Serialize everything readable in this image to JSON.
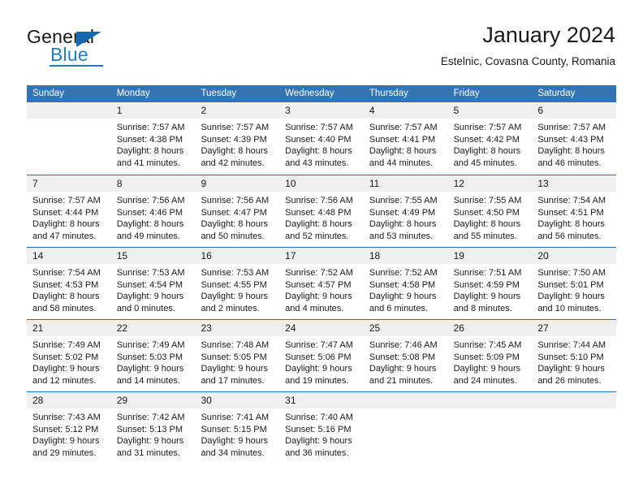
{
  "brand": {
    "name_top": "General",
    "name_bottom": "Blue",
    "logo_icon": "triangle-logo-icon",
    "accent_color": "#1668b0",
    "blue_text_color": "#1d7dc4"
  },
  "header": {
    "title": "January 2024",
    "subtitle": "Estelnic, Covasna County, Romania"
  },
  "theme": {
    "header_row_bg": "#3274b4",
    "header_row_text": "#ffffff",
    "week_separator": "#2a6cae",
    "day_number_band_bg": "#efefef",
    "body_text": "#1a1a1a"
  },
  "calendar": {
    "weekdays": [
      "Sunday",
      "Monday",
      "Tuesday",
      "Wednesday",
      "Thursday",
      "Friday",
      "Saturday"
    ],
    "weeks": [
      [
        {
          "day": "",
          "lines": []
        },
        {
          "day": "1",
          "lines": [
            "Sunrise: 7:57 AM",
            "Sunset: 4:38 PM",
            "Daylight: 8 hours",
            "and 41 minutes."
          ]
        },
        {
          "day": "2",
          "lines": [
            "Sunrise: 7:57 AM",
            "Sunset: 4:39 PM",
            "Daylight: 8 hours",
            "and 42 minutes."
          ]
        },
        {
          "day": "3",
          "lines": [
            "Sunrise: 7:57 AM",
            "Sunset: 4:40 PM",
            "Daylight: 8 hours",
            "and 43 minutes."
          ]
        },
        {
          "day": "4",
          "lines": [
            "Sunrise: 7:57 AM",
            "Sunset: 4:41 PM",
            "Daylight: 8 hours",
            "and 44 minutes."
          ]
        },
        {
          "day": "5",
          "lines": [
            "Sunrise: 7:57 AM",
            "Sunset: 4:42 PM",
            "Daylight: 8 hours",
            "and 45 minutes."
          ]
        },
        {
          "day": "6",
          "lines": [
            "Sunrise: 7:57 AM",
            "Sunset: 4:43 PM",
            "Daylight: 8 hours",
            "and 46 minutes."
          ]
        }
      ],
      [
        {
          "day": "7",
          "lines": [
            "Sunrise: 7:57 AM",
            "Sunset: 4:44 PM",
            "Daylight: 8 hours",
            "and 47 minutes."
          ]
        },
        {
          "day": "8",
          "lines": [
            "Sunrise: 7:56 AM",
            "Sunset: 4:46 PM",
            "Daylight: 8 hours",
            "and 49 minutes."
          ]
        },
        {
          "day": "9",
          "lines": [
            "Sunrise: 7:56 AM",
            "Sunset: 4:47 PM",
            "Daylight: 8 hours",
            "and 50 minutes."
          ]
        },
        {
          "day": "10",
          "lines": [
            "Sunrise: 7:56 AM",
            "Sunset: 4:48 PM",
            "Daylight: 8 hours",
            "and 52 minutes."
          ]
        },
        {
          "day": "11",
          "lines": [
            "Sunrise: 7:55 AM",
            "Sunset: 4:49 PM",
            "Daylight: 8 hours",
            "and 53 minutes."
          ]
        },
        {
          "day": "12",
          "lines": [
            "Sunrise: 7:55 AM",
            "Sunset: 4:50 PM",
            "Daylight: 8 hours",
            "and 55 minutes."
          ]
        },
        {
          "day": "13",
          "lines": [
            "Sunrise: 7:54 AM",
            "Sunset: 4:51 PM",
            "Daylight: 8 hours",
            "and 56 minutes."
          ]
        }
      ],
      [
        {
          "day": "14",
          "lines": [
            "Sunrise: 7:54 AM",
            "Sunset: 4:53 PM",
            "Daylight: 8 hours",
            "and 58 minutes."
          ]
        },
        {
          "day": "15",
          "lines": [
            "Sunrise: 7:53 AM",
            "Sunset: 4:54 PM",
            "Daylight: 9 hours",
            "and 0 minutes."
          ]
        },
        {
          "day": "16",
          "lines": [
            "Sunrise: 7:53 AM",
            "Sunset: 4:55 PM",
            "Daylight: 9 hours",
            "and 2 minutes."
          ]
        },
        {
          "day": "17",
          "lines": [
            "Sunrise: 7:52 AM",
            "Sunset: 4:57 PM",
            "Daylight: 9 hours",
            "and 4 minutes."
          ]
        },
        {
          "day": "18",
          "lines": [
            "Sunrise: 7:52 AM",
            "Sunset: 4:58 PM",
            "Daylight: 9 hours",
            "and 6 minutes."
          ]
        },
        {
          "day": "19",
          "lines": [
            "Sunrise: 7:51 AM",
            "Sunset: 4:59 PM",
            "Daylight: 9 hours",
            "and 8 minutes."
          ]
        },
        {
          "day": "20",
          "lines": [
            "Sunrise: 7:50 AM",
            "Sunset: 5:01 PM",
            "Daylight: 9 hours",
            "and 10 minutes."
          ]
        }
      ],
      [
        {
          "day": "21",
          "lines": [
            "Sunrise: 7:49 AM",
            "Sunset: 5:02 PM",
            "Daylight: 9 hours",
            "and 12 minutes."
          ]
        },
        {
          "day": "22",
          "lines": [
            "Sunrise: 7:49 AM",
            "Sunset: 5:03 PM",
            "Daylight: 9 hours",
            "and 14 minutes."
          ]
        },
        {
          "day": "23",
          "lines": [
            "Sunrise: 7:48 AM",
            "Sunset: 5:05 PM",
            "Daylight: 9 hours",
            "and 17 minutes."
          ]
        },
        {
          "day": "24",
          "lines": [
            "Sunrise: 7:47 AM",
            "Sunset: 5:06 PM",
            "Daylight: 9 hours",
            "and 19 minutes."
          ]
        },
        {
          "day": "25",
          "lines": [
            "Sunrise: 7:46 AM",
            "Sunset: 5:08 PM",
            "Daylight: 9 hours",
            "and 21 minutes."
          ]
        },
        {
          "day": "26",
          "lines": [
            "Sunrise: 7:45 AM",
            "Sunset: 5:09 PM",
            "Daylight: 9 hours",
            "and 24 minutes."
          ]
        },
        {
          "day": "27",
          "lines": [
            "Sunrise: 7:44 AM",
            "Sunset: 5:10 PM",
            "Daylight: 9 hours",
            "and 26 minutes."
          ]
        }
      ],
      [
        {
          "day": "28",
          "lines": [
            "Sunrise: 7:43 AM",
            "Sunset: 5:12 PM",
            "Daylight: 9 hours",
            "and 29 minutes."
          ]
        },
        {
          "day": "29",
          "lines": [
            "Sunrise: 7:42 AM",
            "Sunset: 5:13 PM",
            "Daylight: 9 hours",
            "and 31 minutes."
          ]
        },
        {
          "day": "30",
          "lines": [
            "Sunrise: 7:41 AM",
            "Sunset: 5:15 PM",
            "Daylight: 9 hours",
            "and 34 minutes."
          ]
        },
        {
          "day": "31",
          "lines": [
            "Sunrise: 7:40 AM",
            "Sunset: 5:16 PM",
            "Daylight: 9 hours",
            "and 36 minutes."
          ]
        },
        {
          "day": "",
          "lines": []
        },
        {
          "day": "",
          "lines": []
        },
        {
          "day": "",
          "lines": []
        }
      ]
    ]
  }
}
